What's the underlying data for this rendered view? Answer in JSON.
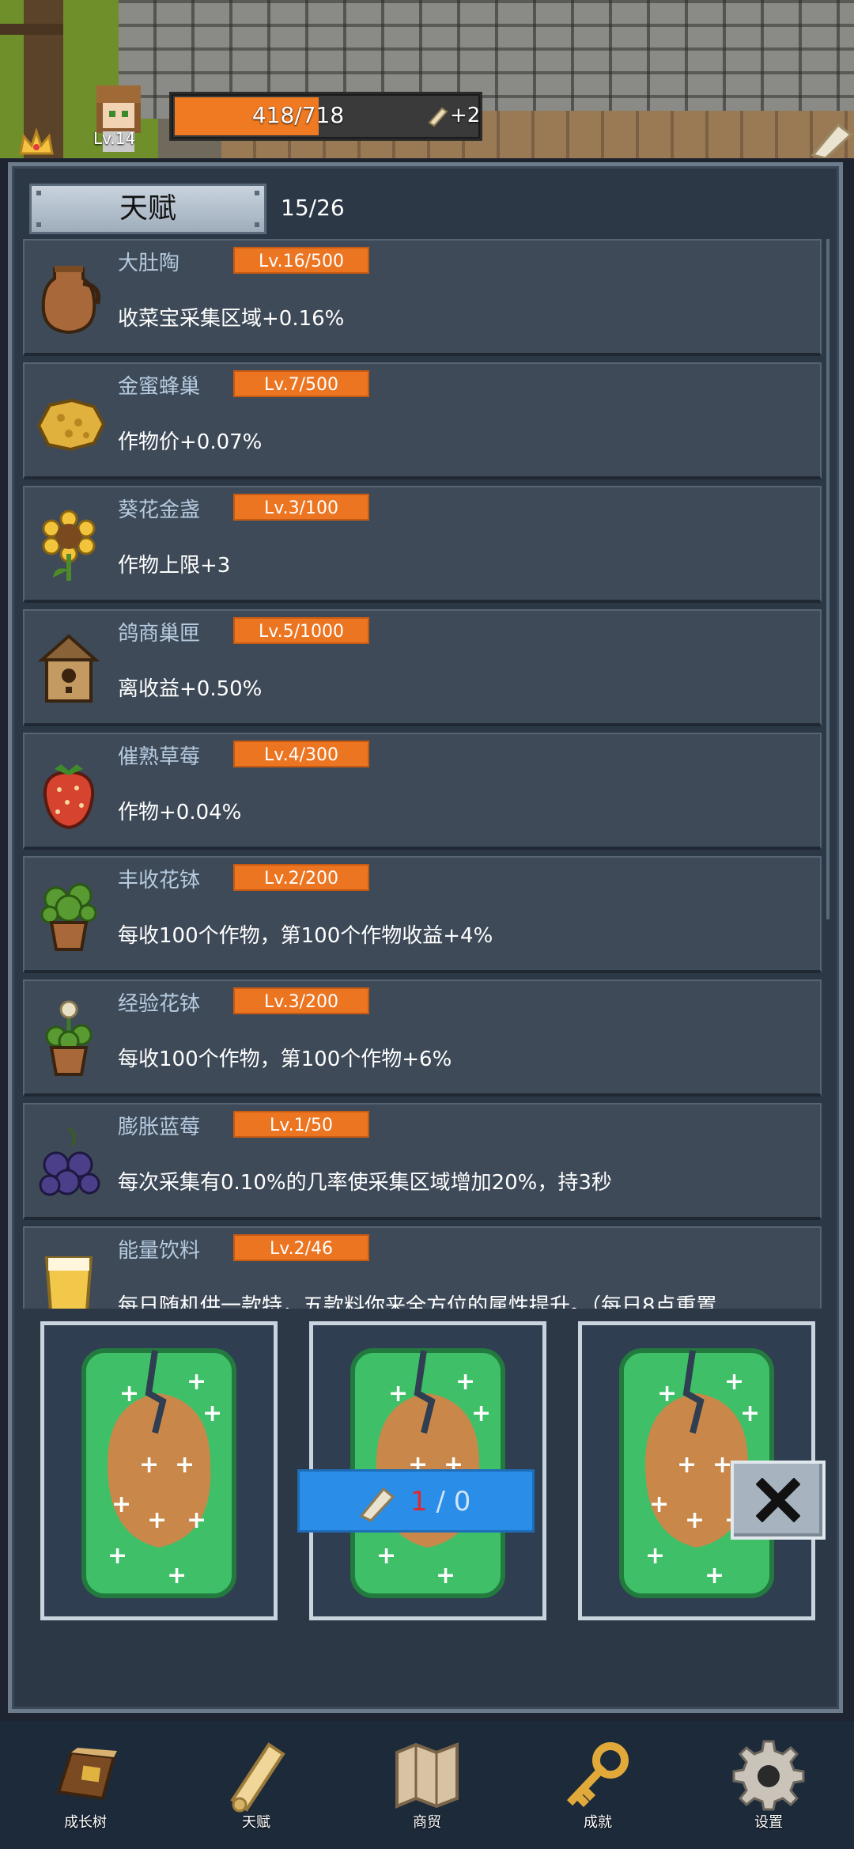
{
  "player": {
    "level": "Lv.14",
    "xp_text": "418/718",
    "xp_fraction": 0.582,
    "bonus": "+2"
  },
  "panel": {
    "title": "天赋",
    "count": "15/26"
  },
  "talents": [
    {
      "name": "大肚陶",
      "level": "Lv.16/500",
      "desc": "收菜宝采集区域+0.16%",
      "icon": "jug-icon"
    },
    {
      "name": "金蜜蜂巢",
      "level": "Lv.7/500",
      "desc": "作物价+0.07%",
      "icon": "honeycomb-icon"
    },
    {
      "name": "葵花金盏",
      "level": "Lv.3/100",
      "desc": "作物上限+3",
      "icon": "sunflower-icon"
    },
    {
      "name": "鸽商巢匣",
      "level": "Lv.5/1000",
      "desc": "离收益+0.50%",
      "icon": "birdhouse-icon"
    },
    {
      "name": "催熟草莓",
      "level": "Lv.4/300",
      "desc": "作物+0.04%",
      "icon": "strawberry-icon"
    },
    {
      "name": "丰收花钵",
      "level": "Lv.2/200",
      "desc": "每收100个作物，第100个作物收益+4%",
      "icon": "plant-pot-icon"
    },
    {
      "name": "经验花钵",
      "level": "Lv.3/200",
      "desc": "每收100个作物，第100个作物+6%",
      "icon": "flower-pot-icon"
    },
    {
      "name": "膨胀蓝莓",
      "level": "Lv.1/50",
      "desc": "每次采集有0.10%的几率使采集区域增加20%，持3秒",
      "icon": "blueberry-icon"
    },
    {
      "name": "能量饮料",
      "level": "Lv.2/46",
      "desc": "每日随机供一款特，五款料你来全方位的属性提升。（每日8点重置",
      "icon": "drink-icon"
    }
  ],
  "reroll": {
    "current": "1",
    "separator": " / ",
    "total": "0"
  },
  "nav": [
    {
      "label": "成长树",
      "icon": "book-icon"
    },
    {
      "label": "天赋",
      "icon": "scroll-icon"
    },
    {
      "label": "商贸",
      "icon": "map-icon"
    },
    {
      "label": "成就",
      "icon": "key-icon"
    },
    {
      "label": "设置",
      "icon": "gear-icon"
    }
  ],
  "colors": {
    "accent_orange": "#ec7522",
    "button_blue": "#2a8de8",
    "card_green": "#3fbf68",
    "panel_bg": "#2c3846"
  }
}
